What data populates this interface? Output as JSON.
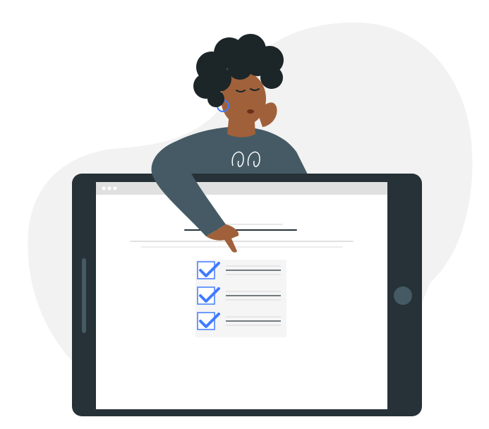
{
  "illustration": {
    "subject": "person-leaning-on-tablet-checklist",
    "checklist": {
      "items": [
        {
          "checked": true
        },
        {
          "checked": true
        },
        {
          "checked": true
        }
      ]
    }
  },
  "colors": {
    "background_blob": "#f2f2f2",
    "tablet_frame": "#263238",
    "screen": "#ffffff",
    "browser_bar": "#e0e0e0",
    "check_accent": "#407bff",
    "shirt": "#455a64",
    "skin": "#a0613a",
    "hair": "#1c2528"
  }
}
